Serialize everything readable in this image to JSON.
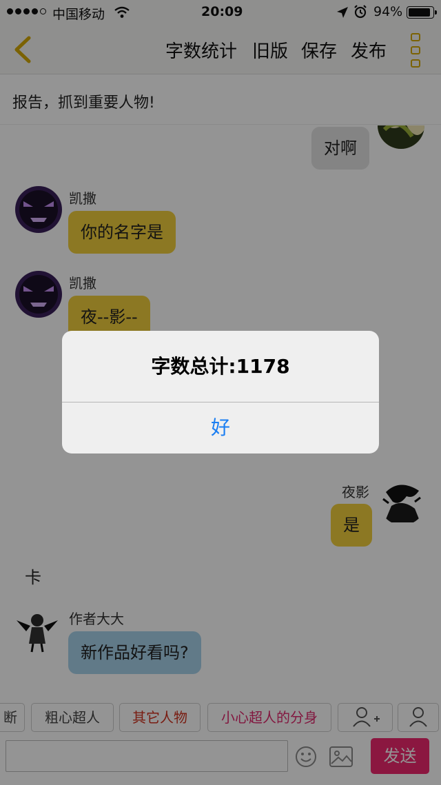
{
  "status_bar": {
    "carrier": "中国移动",
    "time": "20:09",
    "battery": "94%"
  },
  "nav": {
    "word_count_label": "字数统计",
    "old_version_label": "旧版",
    "save_label": "保存",
    "publish_label": "发布"
  },
  "story_title": "报告，抓到重要人物!",
  "messages": [
    {
      "side": "right",
      "text": "对啊",
      "style": "grey"
    },
    {
      "side": "left",
      "sender": "凯撒",
      "text": "你的名字是",
      "style": "gold"
    },
    {
      "side": "left",
      "sender": "凯撒",
      "text": "夜--影--",
      "style": "gold"
    },
    {
      "side": "right",
      "sender": "夜影",
      "text": "是",
      "style": "gold"
    },
    {
      "side": "narration",
      "text": "卡"
    },
    {
      "side": "left",
      "sender": "作者大大",
      "text": "新作品好看吗?",
      "style": "blue"
    }
  ],
  "characters": [
    "断",
    "粗心超人",
    "其它人物",
    "小心超人的分身"
  ],
  "input": {
    "value": "",
    "send_label": "发送"
  },
  "alert": {
    "message": "字数总计:1178",
    "ok_label": "好"
  },
  "colors": {
    "accent_gold": "#f2cf3d",
    "send_pink": "#f0286e",
    "alert_button_blue": "#1a7ef2"
  }
}
